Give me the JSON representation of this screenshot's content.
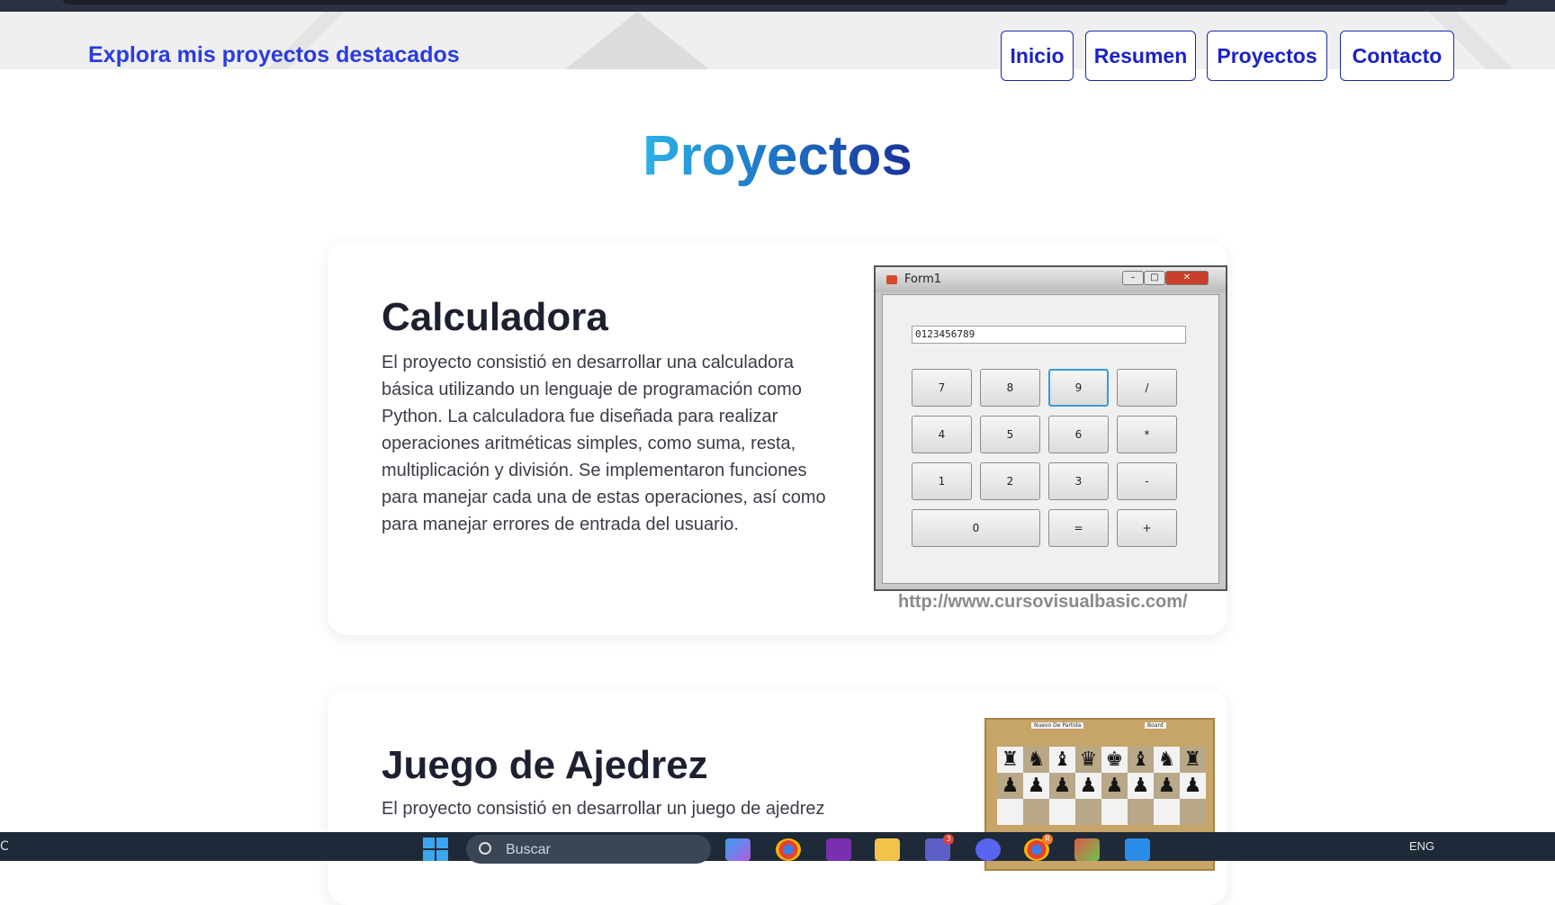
{
  "header": {
    "brand": "Explora mis proyectos destacados",
    "nav": [
      {
        "label": "Inicio"
      },
      {
        "label": "Resumen"
      },
      {
        "label": "Proyectos"
      },
      {
        "label": "Contacto"
      }
    ]
  },
  "section": {
    "title": "Proyectos"
  },
  "projects": [
    {
      "title": "Calculadora",
      "description": "El proyecto consistió en desarrollar una calculadora básica utilizando un lenguaje de programación como Python. La calculadora fue diseñada para realizar operaciones aritméticas simples, como suma, resta, multiplicación y división. Se implementaron funciones para manejar cada una de estas operaciones, así como para manejar errores de entrada del usuario.",
      "image": {
        "window_title": "Form1",
        "display_value": "0123456789",
        "keys": [
          "7",
          "8",
          "9",
          "/",
          "4",
          "5",
          "6",
          "*",
          "1",
          "2",
          "3",
          "-",
          "0",
          "=",
          "+"
        ],
        "watermark": "http://www.cursovisualbasic.com/"
      }
    },
    {
      "title": "Juego de Ajedrez",
      "description": "El proyecto consistió en desarrollar un juego de ajedrez",
      "image": {
        "labels": [
          "Nuevo De Partida",
          "Board"
        ]
      }
    }
  ],
  "taskbar": {
    "left_text": "C",
    "search_placeholder": "Buscar",
    "tray_language": "ENG",
    "badges": {
      "teams": "3",
      "chrome": "R"
    }
  },
  "colors": {
    "brand": "#2b3ce0",
    "nav_border": "#1c2aa8",
    "title_gradient_start": "#2bb2e8",
    "title_gradient_end": "#1a2f9a"
  }
}
